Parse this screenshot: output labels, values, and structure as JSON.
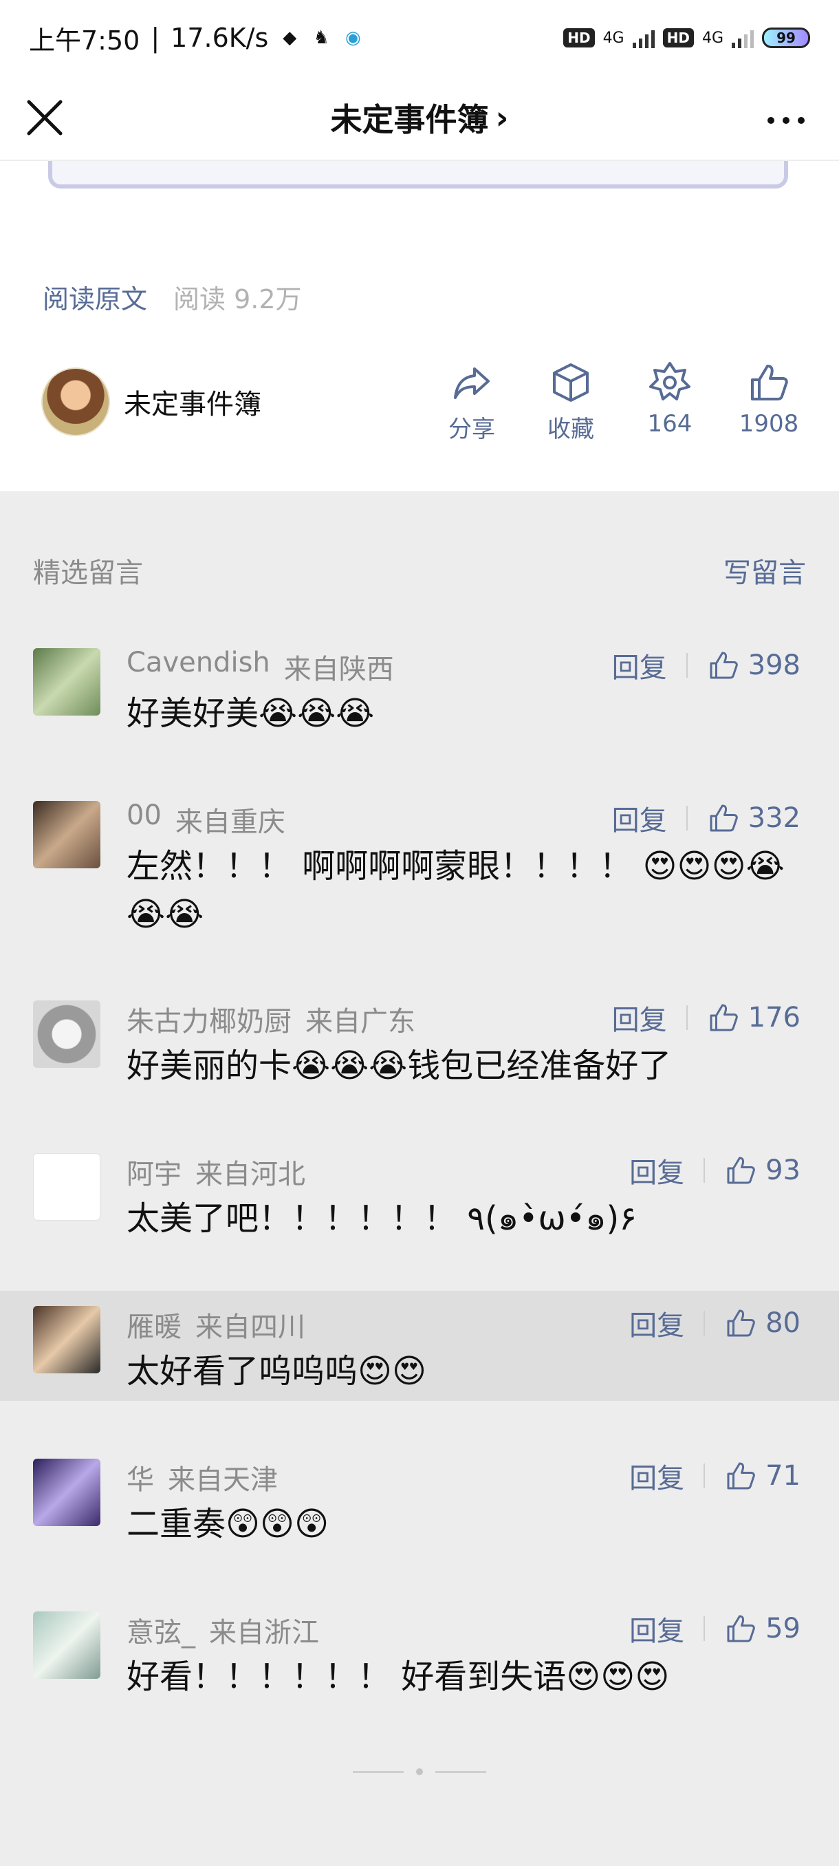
{
  "status_bar": {
    "time": "上午7:50",
    "speed": "17.6K/s",
    "net1": "4G",
    "net2": "4G",
    "hd1": "HD",
    "hd2": "HD",
    "battery": "99"
  },
  "header": {
    "title": "未定事件簿",
    "chevron": "›"
  },
  "article": {
    "read_original": "阅读原文",
    "read_count": "阅读 9.2万",
    "author_name": "未定事件簿",
    "actions": [
      {
        "label": "分享",
        "icon": "share-icon"
      },
      {
        "label": "收藏",
        "icon": "box-icon"
      },
      {
        "label": "164",
        "icon": "wow-icon"
      },
      {
        "label": "1908",
        "icon": "thumb-up-icon"
      }
    ]
  },
  "comments_section": {
    "title": "精选留言",
    "write_label": "写留言"
  },
  "comments": [
    {
      "name": "Cavendish",
      "location": "来自陕西",
      "reply": "回复",
      "likes": "398",
      "text": "好美好美😭😭😭"
    },
    {
      "name": "00",
      "location": "来自重庆",
      "reply": "回复",
      "likes": "332",
      "text": "左然！！！ 啊啊啊啊蒙眼！！！！ 😍😍😍😭😭😭"
    },
    {
      "name": "朱古力椰奶厨",
      "location": "来自广东",
      "reply": "回复",
      "likes": "176",
      "text": "好美丽的卡😭😭😭钱包已经准备好了"
    },
    {
      "name": "阿宇",
      "location": "来自河北",
      "reply": "回复",
      "likes": "93",
      "text": "太美了吧！！！！！！ ٩(๑•̀ω•́๑)۶"
    },
    {
      "name": "雁暖",
      "location": "来自四川",
      "reply": "回复",
      "likes": "80",
      "text": "太好看了呜呜呜😍😍"
    },
    {
      "name": "华",
      "location": "来自天津",
      "reply": "回复",
      "likes": "71",
      "text": "二重奏😲😲😲"
    },
    {
      "name": "意弦_",
      "location": "来自浙江",
      "reply": "回复",
      "likes": "59",
      "text": "好看！！！！！！ 好看到失语😍😍😍"
    }
  ],
  "colors": {
    "link": "#576b95",
    "muted": "#8b8b8b",
    "background": "#ededed"
  }
}
